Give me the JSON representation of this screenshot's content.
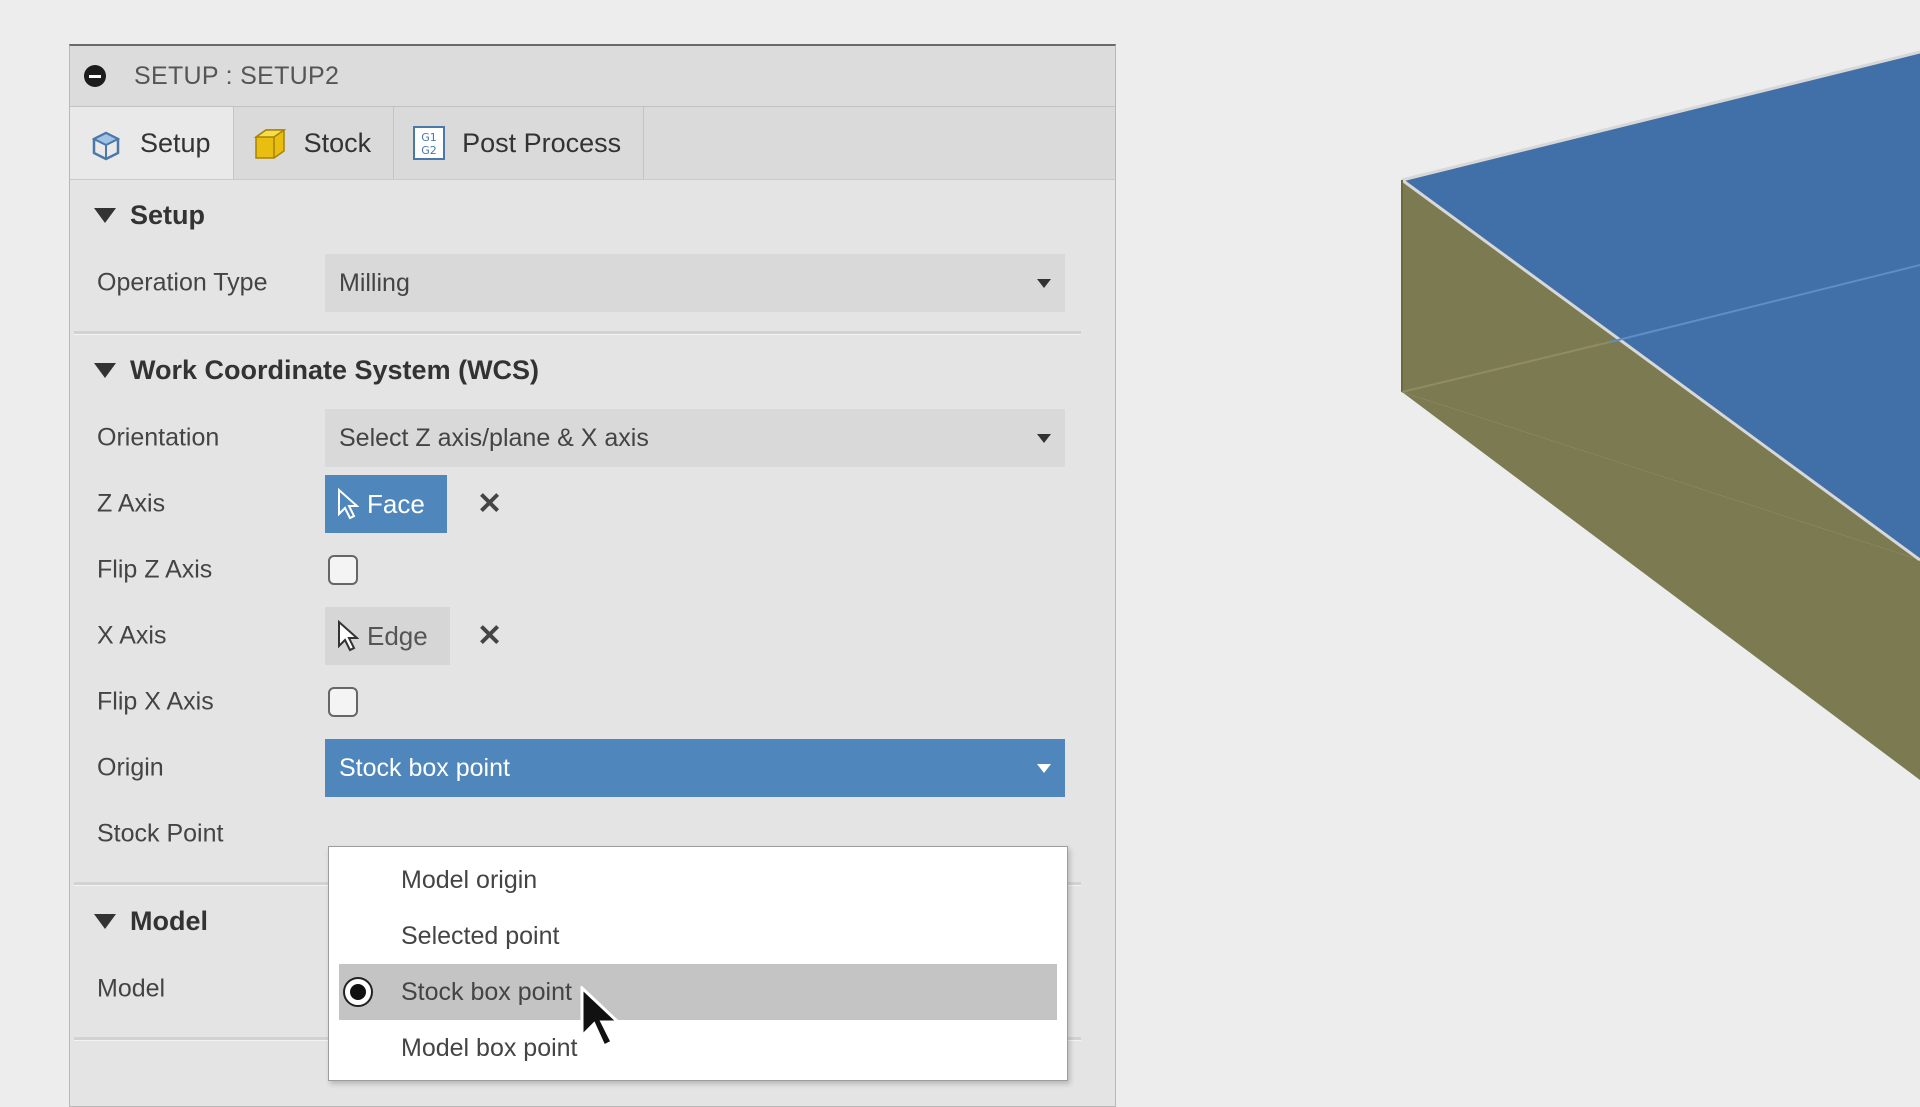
{
  "panel": {
    "title": "SETUP : SETUP2"
  },
  "tabs": [
    {
      "label": "Setup",
      "icon": "setup-cube-icon"
    },
    {
      "label": "Stock",
      "icon": "stock-box-icon"
    },
    {
      "label": "Post Process",
      "icon": "g1g2-icon"
    }
  ],
  "setup_section": {
    "title": "Setup",
    "operation_type_label": "Operation Type",
    "operation_type_value": "Milling"
  },
  "wcs_section": {
    "title": "Work Coordinate System (WCS)",
    "orientation_label": "Orientation",
    "orientation_value": "Select Z axis/plane & X axis",
    "z_axis_label": "Z Axis",
    "z_axis_value": "Face",
    "flip_z_label": "Flip Z Axis",
    "x_axis_label": "X Axis",
    "x_axis_value": "Edge",
    "flip_x_label": "Flip X Axis",
    "origin_label": "Origin",
    "origin_value": "Stock box point",
    "stock_point_label": "Stock Point",
    "clear_symbol": "✕"
  },
  "origin_menu": {
    "options": [
      "Model origin",
      "Selected point",
      "Stock box point",
      "Model box point"
    ],
    "selected_index": 2
  },
  "model_section": {
    "title": "Model",
    "model_label": "Model"
  },
  "colors": {
    "accent": "#4f87bd",
    "stock_top": "#4170a8",
    "stock_side": "#7c7a50"
  }
}
